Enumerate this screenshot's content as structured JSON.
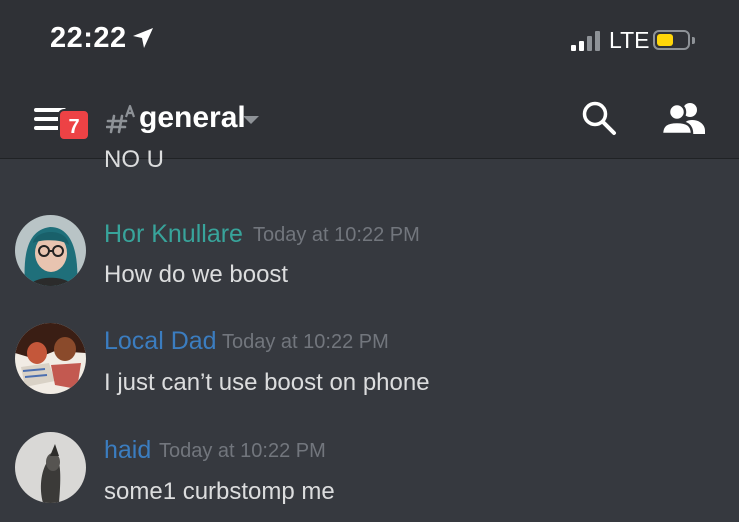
{
  "status_bar": {
    "time": "22:22",
    "network": "LTE",
    "location_icon": "location-arrow-icon",
    "signal_icon": "signal-bars-icon",
    "battery_icon": "battery-icon",
    "battery_level": 0.55,
    "battery_color": "#ffd60a"
  },
  "header": {
    "menu_icon": "hamburger-menu-icon",
    "badge_count": "7",
    "badge_color": "#ed4245",
    "channel_icon": "text-channel-rules-icon",
    "channel_name": "general",
    "dropdown_icon": "chevron-down-icon",
    "search_icon": "search-icon",
    "members_icon": "members-icon"
  },
  "messages": {
    "partial": {
      "text": "NO U"
    },
    "items": [
      {
        "username": "Hor Knullare",
        "username_color": "#38a49b",
        "timestamp": "Today at 10:22 PM",
        "text": "How do we boost"
      },
      {
        "username": "Local Dad",
        "username_color": "#3b7dc0",
        "timestamp": "Today at 10:22 PM",
        "text": "I just can’t use boost on phone"
      },
      {
        "username": "haid",
        "username_color": "#3b7dc0",
        "timestamp": "Today at 10:22 PM",
        "text": "some1 curbstomp me"
      }
    ]
  }
}
